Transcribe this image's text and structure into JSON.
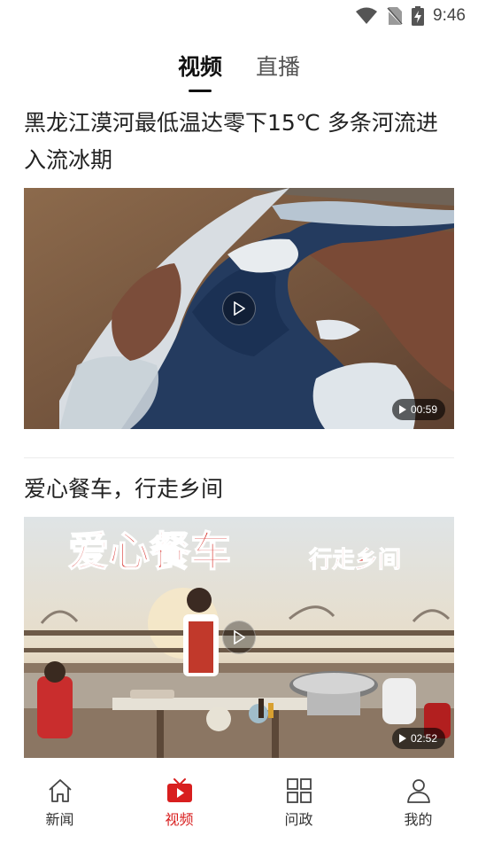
{
  "status_bar": {
    "time": "9:46"
  },
  "top_tabs": [
    {
      "label": "视频",
      "active": true
    },
    {
      "label": "直播",
      "active": false
    }
  ],
  "feed": [
    {
      "title": "黑龙江漠河最低温达零下15℃ 多条河流进入流冰期",
      "duration": "00:59"
    },
    {
      "title": "爱心餐车，行走乡间",
      "duration": "02:52",
      "thumbnail_caption": "爱心餐车",
      "thumbnail_subcaption": "行走乡间"
    }
  ],
  "bottom_nav": [
    {
      "label": "新闻",
      "icon": "home-icon",
      "active": false
    },
    {
      "label": "视频",
      "icon": "tv-icon",
      "active": true
    },
    {
      "label": "问政",
      "icon": "grid-icon",
      "active": false
    },
    {
      "label": "我的",
      "icon": "user-icon",
      "active": false
    }
  ],
  "colors": {
    "accent": "#d81e1e",
    "text": "#222222",
    "divider": "#ececec"
  }
}
